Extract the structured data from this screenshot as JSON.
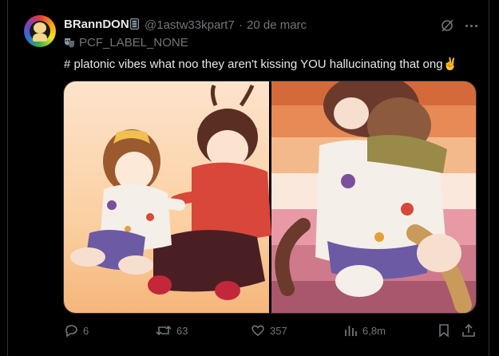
{
  "post": {
    "author_name": "BRannDON",
    "author_handle": "@1astw33kpart7",
    "separator": "·",
    "date": "20 de marc",
    "label": "PCF_LABEL_NONE",
    "text": "# platonic vibes what noo they aren't kissing YOU hallucinating that ong✌️"
  },
  "actions": {
    "replies": "6",
    "reposts": "63",
    "likes": "357",
    "views": "6,8m"
  },
  "icons": {
    "avatar": "avatar-image",
    "badge": "id-card-icon",
    "grok": "grok-slash-icon",
    "more": "more-dots-icon",
    "label": "masks-icon",
    "reply": "reply-icon",
    "repost": "repost-icon",
    "like": "heart-icon",
    "views": "views-chart-icon",
    "bookmark": "bookmark-icon",
    "share": "share-icon"
  },
  "colors": {
    "background": "#000000",
    "text_primary": "#e7e9ea",
    "text_secondary": "#71767b",
    "border": "#2f3336"
  }
}
